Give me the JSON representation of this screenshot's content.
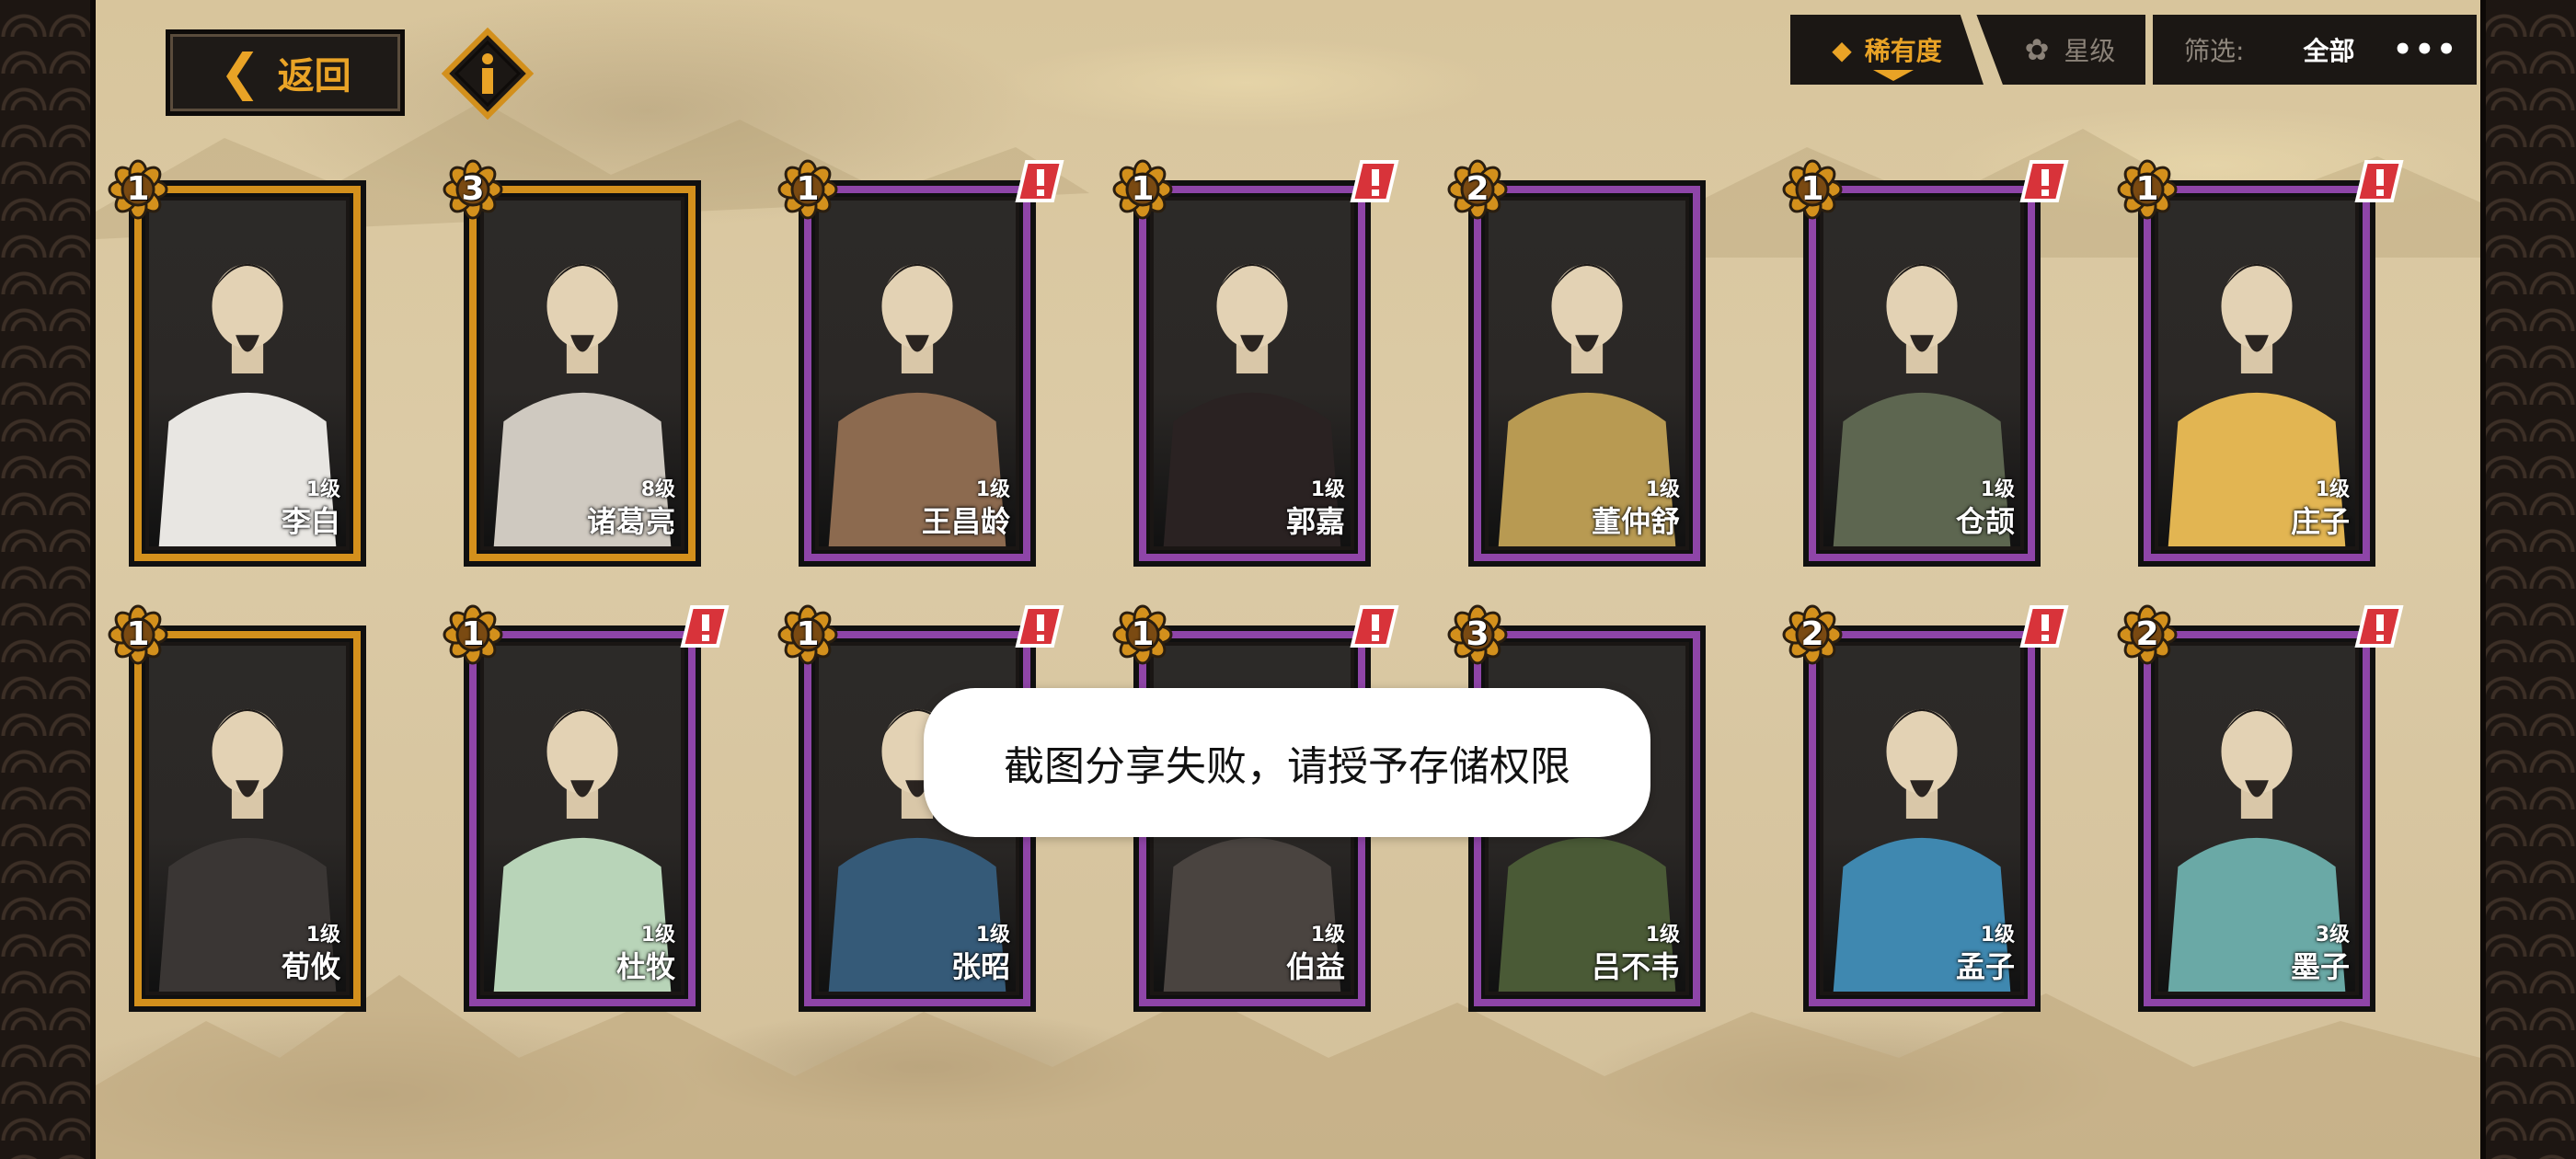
{
  "top": {
    "back_label": "返回",
    "tab_rarity": "稀有度",
    "tab_star": "星级",
    "filter_label": "筛选:",
    "filter_value": "全部",
    "more": "•••"
  },
  "colors": {
    "gold_frame": "#d3901c",
    "purple_frame": "#8e45a8",
    "accent": "#e9a326",
    "alert_red": "#d8333a"
  },
  "cards_row1": [
    {
      "badge": "1",
      "level": "1级",
      "name": "李白",
      "rarity": "gold",
      "alert": false,
      "robe": "#e8e6e2"
    },
    {
      "badge": "3",
      "level": "8级",
      "name": "诸葛亮",
      "rarity": "gold",
      "alert": false,
      "robe": "#cfc9c0"
    },
    {
      "badge": "1",
      "level": "1级",
      "name": "王昌龄",
      "rarity": "purple",
      "alert": true,
      "robe": "#8c6a4f"
    },
    {
      "badge": "1",
      "level": "1级",
      "name": "郭嘉",
      "rarity": "purple",
      "alert": true,
      "robe": "#2a2222"
    },
    {
      "badge": "2",
      "level": "1级",
      "name": "董仲舒",
      "rarity": "purple",
      "alert": false,
      "robe": "#b89a52"
    },
    {
      "badge": "1",
      "level": "1级",
      "name": "仓颉",
      "rarity": "purple",
      "alert": true,
      "robe": "#5d6650"
    },
    {
      "badge": "1",
      "level": "1级",
      "name": "庄子",
      "rarity": "purple",
      "alert": true,
      "robe": "#e2b552"
    }
  ],
  "cards_row2": [
    {
      "badge": "1",
      "level": "1级",
      "name": "荀攸",
      "rarity": "gold",
      "alert": false,
      "robe": "#3a3634"
    },
    {
      "badge": "1",
      "level": "1级",
      "name": "杜牧",
      "rarity": "purple",
      "alert": true,
      "robe": "#b8d4b8"
    },
    {
      "badge": "1",
      "level": "1级",
      "name": "张昭",
      "rarity": "purple",
      "alert": true,
      "robe": "#355a78"
    },
    {
      "badge": "1",
      "level": "1级",
      "name": "伯益",
      "rarity": "purple",
      "alert": true,
      "robe": "#4a4440"
    },
    {
      "badge": "3",
      "level": "1级",
      "name": "吕不韦",
      "rarity": "purple",
      "alert": false,
      "robe": "#4a5a36"
    },
    {
      "badge": "2",
      "level": "1级",
      "name": "孟子",
      "rarity": "purple",
      "alert": true,
      "robe": "#3f88b0"
    },
    {
      "badge": "2",
      "level": "3级",
      "name": "墨子",
      "rarity": "purple",
      "alert": true,
      "robe": "#6aa9a6"
    }
  ],
  "toast": "截图分享失败，请授予存储权限"
}
